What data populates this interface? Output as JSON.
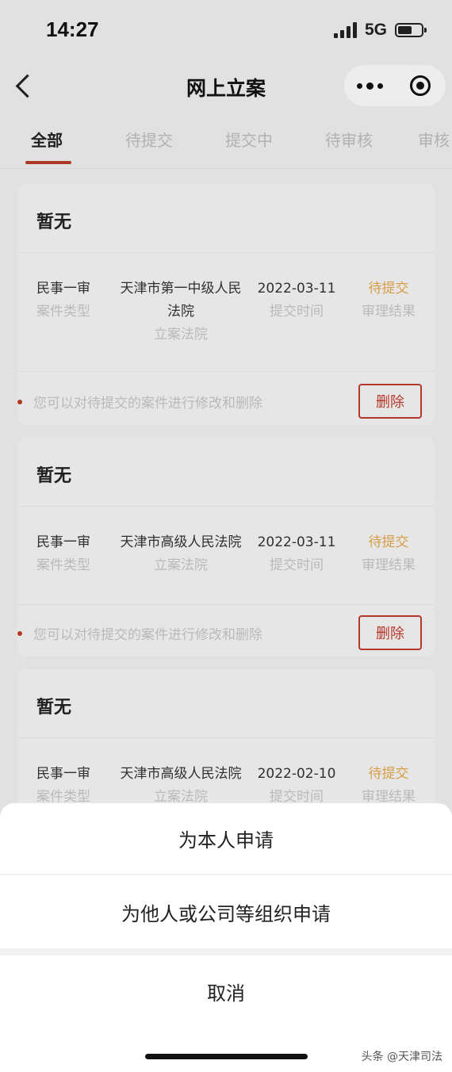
{
  "status_bar": {
    "time": "14:27",
    "network": "5G"
  },
  "nav": {
    "title": "网上立案"
  },
  "tabs": [
    {
      "label": "全部"
    },
    {
      "label": "待提交"
    },
    {
      "label": "提交中"
    },
    {
      "label": "待审核"
    },
    {
      "label": "审核"
    }
  ],
  "cases": [
    {
      "title": "暂无",
      "case_type": "民事一审",
      "case_type_label": "案件类型",
      "court_line1": "天津市第一中级人民",
      "court_line2": "法院",
      "court_label": "立案法院",
      "submit_time": "2022-03-11",
      "submit_time_label": "提交时间",
      "result": "待提交",
      "result_label": "审理结果",
      "note": "您可以对待提交的案件进行修改和删除",
      "delete_label": "删除"
    },
    {
      "title": "暂无",
      "case_type": "民事一审",
      "case_type_label": "案件类型",
      "court_line1": "天津市高级人民法院",
      "court_label": "立案法院",
      "submit_time": "2022-03-11",
      "submit_time_label": "提交时间",
      "result": "待提交",
      "result_label": "审理结果",
      "note": "您可以对待提交的案件进行修改和删除",
      "delete_label": "删除"
    },
    {
      "title": "暂无",
      "case_type": "民事一审",
      "case_type_label": "案件类型",
      "court_line1": "天津市高级人民法院",
      "court_label": "立案法院",
      "submit_time": "2022-02-10",
      "submit_time_label": "提交时间",
      "result": "待提交",
      "result_label": "审理结果"
    }
  ],
  "action_sheet": {
    "option_self": "为本人申请",
    "option_others": "为他人或公司等组织申请",
    "cancel": "取消"
  },
  "watermark": "头条 @天津司法",
  "colors": {
    "accent": "#b73b2a",
    "pending": "#e3a64d"
  }
}
